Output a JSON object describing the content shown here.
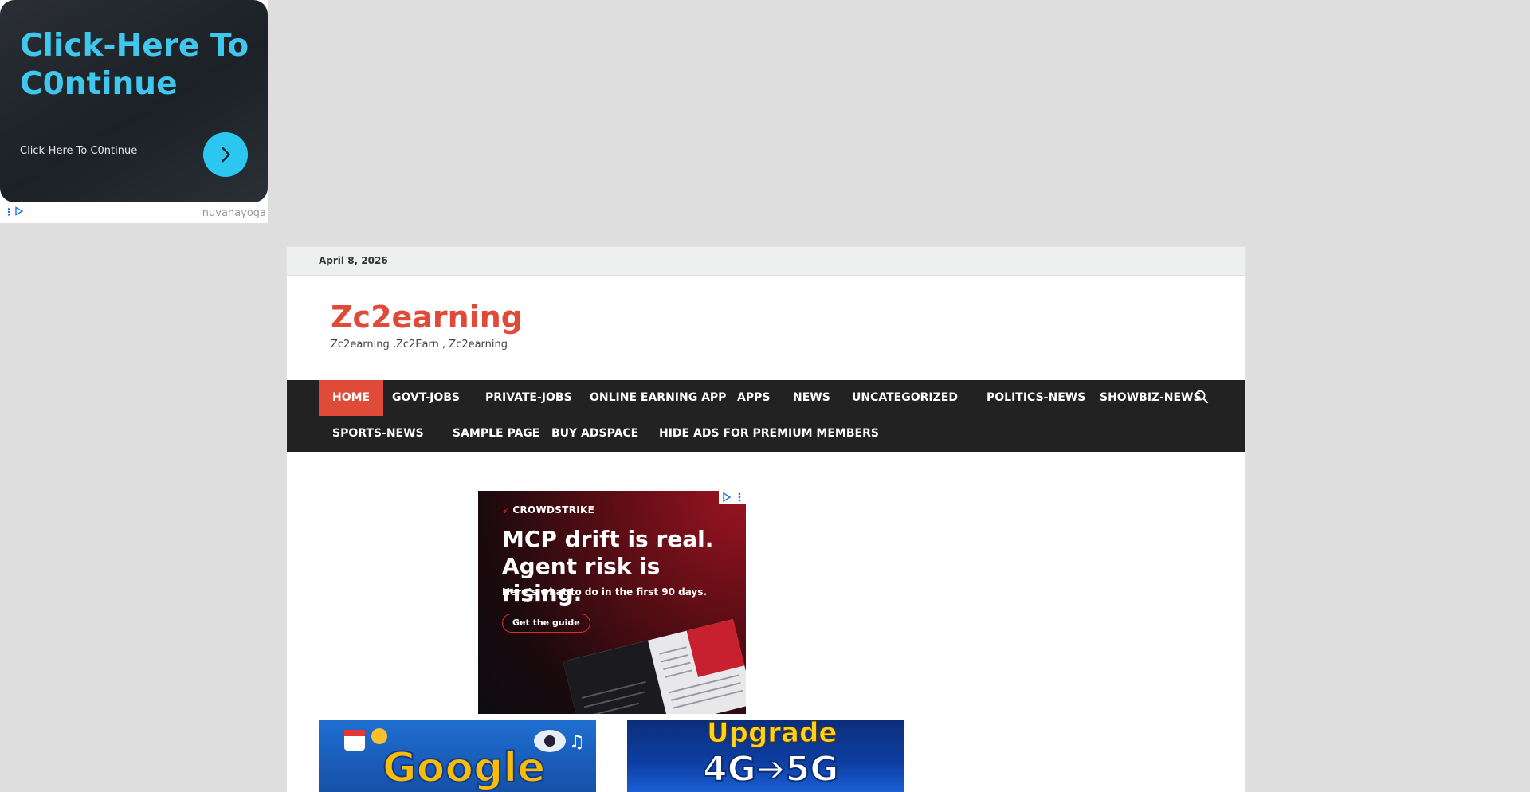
{
  "ad_top": {
    "headline": "Click-Here To C0ntinue",
    "subtext": "Click-Here To C0ntinue",
    "advertiser": "nuvanayoga",
    "accent": "#3fc7ee"
  },
  "header": {
    "date": "April 8, 2026",
    "site_title": "Zc2earning",
    "tagline": "Zc2earning ,Zc2Earn , Zc2earning",
    "brand_color": "#e04b39"
  },
  "nav": {
    "items": [
      {
        "label": "HOME",
        "active": true
      },
      {
        "label": "GOVT-JOBS"
      },
      {
        "label": "PRIVATE-JOBS"
      },
      {
        "label": "ONLINE EARNING APP"
      },
      {
        "label": "APPS"
      },
      {
        "label": "NEWS"
      },
      {
        "label": "UNCATEGORIZED"
      },
      {
        "label": "POLITICS-NEWS"
      },
      {
        "label": "SHOWBIZ-NEWS"
      },
      {
        "label": "SPORTS-NEWS"
      },
      {
        "label": "SAMPLE PAGE"
      },
      {
        "label": "BUY ADSPACE"
      },
      {
        "label": "HIDE ADS FOR PREMIUM MEMBERS"
      }
    ],
    "search_icon": "search-icon"
  },
  "ad_mid": {
    "brand": "CROWDSTRIKE",
    "headline": "MCP drift is real. Agent risk is rising.",
    "subtext": "Here’s what to do in the first 90 days.",
    "cta": "Get the guide"
  },
  "thumbnails": [
    {
      "text": "Google"
    },
    {
      "text_top": "Upgrade",
      "text_bottom": "4G➔5G"
    }
  ]
}
